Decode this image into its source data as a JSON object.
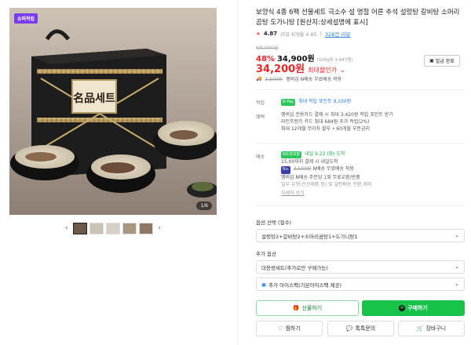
{
  "gallery": {
    "badge": "슈퍼적립",
    "counter": "1/6",
    "box_label": "名品세트",
    "prev_arrow": "‹",
    "next_arrow": "›"
  },
  "product": {
    "title": "보양식 4종 6팩 선물세트 극소수 설 명절 어른 추석 설렁탕 갈비탕 소머리 곰탕 도가니탕 [원산지:상세설명에 표시]",
    "rating": "4.87",
    "rating_count": "리뷰 6개월 4.85",
    "review_link": "328건 리뷰",
    "original_price": "68,000원",
    "discount_rate": "48%",
    "price": "34,900원",
    "unit_price": "(100g당 4,847원)",
    "special_price": "34,200원",
    "special_label": "최대할인가",
    "coupon_label": "발급 완료",
    "ship_old": "3,500원",
    "ship_text": "멤버십 N배송 무료배송 적용"
  },
  "info": {
    "points_label": "적립",
    "points_tag": "N Pay",
    "points_text": "최대 적립 포인트 9,100원",
    "benefit_label": "혜택",
    "benefit_lines": [
      "멤버십 전용카드 결제 시 최대 3,420원 적립 포인트 받기",
      "라인프렌즈 카드 최대 684원 추가 적립(2%)",
      "최대 12개월 무이자 할부 • 60개월 부분금리"
    ],
    "delivery_label": "배송",
    "delivery_tag": "N도착보장",
    "delivery_arrive": "내일 9.22 (화) 도착",
    "delivery_line2": "15,00까지 결제 시 내일도착",
    "delivery_line3_old": "3,500원",
    "delivery_line3": "N배송 무료배송 적용",
    "delivery_line4": "멤버십 N배송 주문당 1회 무료교환/반품",
    "delivery_line5": "일부 유형(신선제품 등) 및 일반배송 전환 제외",
    "details_link": "자세히 보기"
  },
  "options": {
    "section_title": "옵션 선택 (필수)",
    "option1": "설렁탕2+갈비탕2+소머리곰탕1+도가니탕1",
    "extra_title": "추가 옵션",
    "extra1": "대용량세트(추가로만 구매가능)",
    "extra2": "추가 아이스팩(기본아이스팩 제공)"
  },
  "actions": {
    "gift": "선물하기",
    "buy": "구매하기",
    "wish": "찜하기",
    "talk": "톡톡문의",
    "cart": "장바구니"
  }
}
